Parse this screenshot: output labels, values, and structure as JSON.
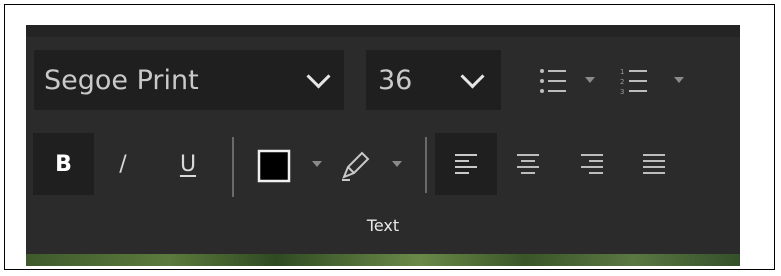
{
  "font": {
    "value": "Segoe Print"
  },
  "size": {
    "value": "36"
  },
  "formatting": {
    "bold": "B",
    "italic": "/",
    "underline": "U"
  },
  "group_label": "Text",
  "icons": [
    "chevron-down-icon",
    "bullet-list-icon",
    "numbered-list-icon",
    "font-color-icon",
    "highlighter-icon",
    "align-left-icon",
    "align-center-icon",
    "align-right-icon",
    "align-justify-icon"
  ],
  "colors": {
    "panel": "#2b2b2b",
    "field": "#1f1f1f",
    "text": "#cfcfcf",
    "font_color_swatch": "#000000"
  }
}
